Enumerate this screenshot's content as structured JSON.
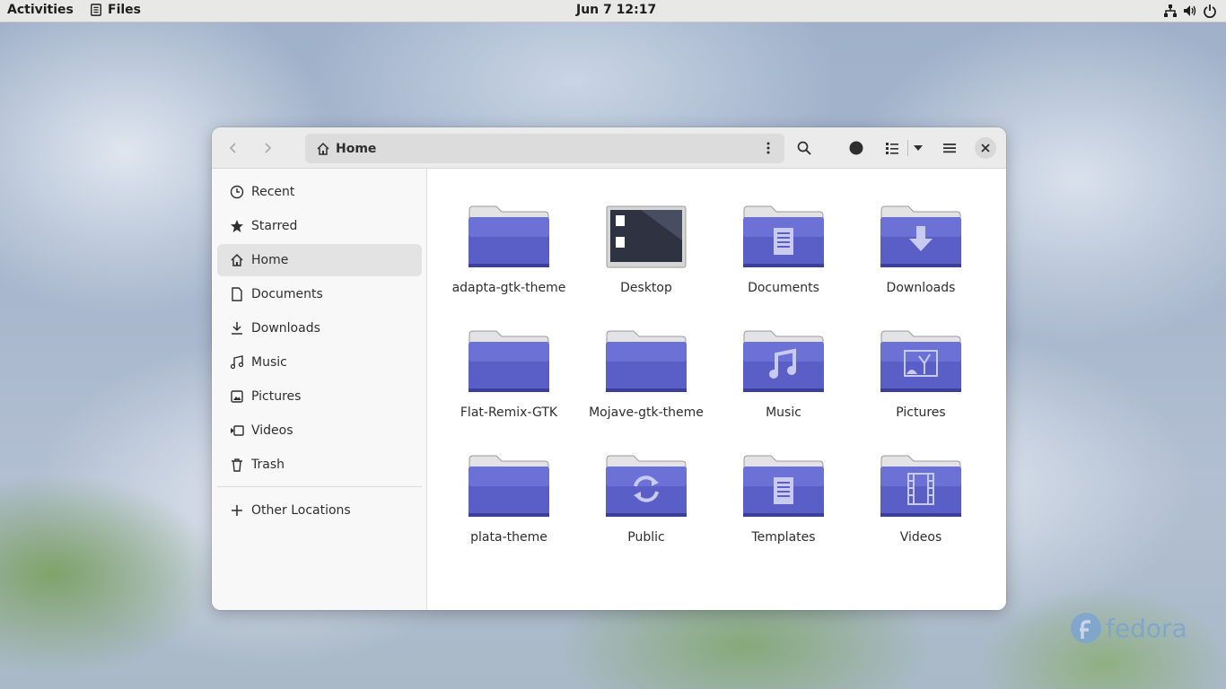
{
  "topbar": {
    "activities": "Activities",
    "app_name": "Files",
    "clock": "Jun 7  12:17",
    "tray_icons": [
      "network-icon",
      "volume-icon",
      "power-icon"
    ]
  },
  "window": {
    "location": "Home",
    "sidebar": {
      "items": [
        {
          "label": "Recent",
          "icon": "clock-icon"
        },
        {
          "label": "Starred",
          "icon": "star-icon"
        },
        {
          "label": "Home",
          "icon": "home-icon",
          "active": true
        },
        {
          "label": "Documents",
          "icon": "document-icon"
        },
        {
          "label": "Downloads",
          "icon": "download-icon"
        },
        {
          "label": "Music",
          "icon": "music-icon"
        },
        {
          "label": "Pictures",
          "icon": "picture-icon"
        },
        {
          "label": "Videos",
          "icon": "video-icon"
        },
        {
          "label": "Trash",
          "icon": "trash-icon"
        }
      ],
      "other_locations": "Other Locations"
    },
    "files": [
      {
        "name": "adapta-gtk-theme",
        "type": "folder"
      },
      {
        "name": "Desktop",
        "type": "desktop"
      },
      {
        "name": "Documents",
        "type": "folder-documents"
      },
      {
        "name": "Downloads",
        "type": "folder-downloads"
      },
      {
        "name": "Flat-Remix-GTK",
        "type": "folder"
      },
      {
        "name": "Mojave-gtk-theme",
        "type": "folder"
      },
      {
        "name": "Music",
        "type": "folder-music"
      },
      {
        "name": "Pictures",
        "type": "folder-pictures"
      },
      {
        "name": "plata-theme",
        "type": "folder"
      },
      {
        "name": "Public",
        "type": "folder-public"
      },
      {
        "name": "Templates",
        "type": "folder-templates"
      },
      {
        "name": "Videos",
        "type": "folder-videos"
      }
    ]
  },
  "colors": {
    "folder_body": "#5a5fc8",
    "folder_tab": "#e3e3e6",
    "accent": "#3584e4"
  },
  "desktop": {
    "brand": "fedora"
  }
}
